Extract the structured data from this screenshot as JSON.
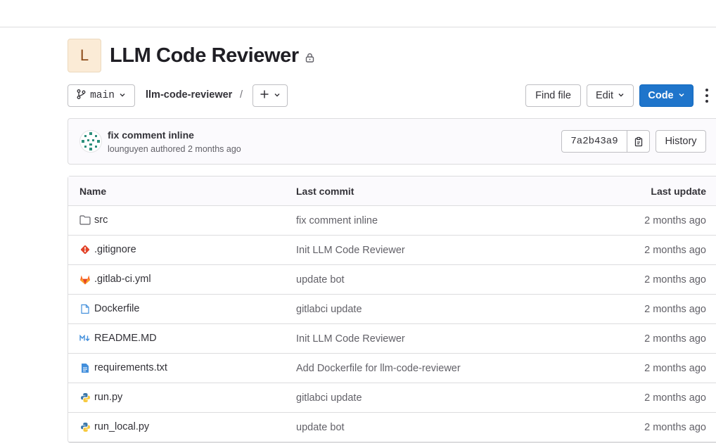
{
  "project": {
    "avatar_letter": "L",
    "name": "LLM Code Reviewer",
    "visibility_icon": "lock-icon"
  },
  "toolbar": {
    "branch": "main",
    "branch_icon": "branch-icon",
    "path_root": "llm-code-reviewer",
    "path_separator": "/",
    "add_icon": "plus-icon",
    "find_file_label": "Find file",
    "edit_label": "Edit",
    "code_label": "Code",
    "more_icon": "kebab-icon",
    "accent_color": "#1f75cb"
  },
  "last_commit": {
    "title": "fix comment inline",
    "meta": "lounguyen authored 2 months ago",
    "sha": "7a2b43a9",
    "copy_icon": "copy-icon",
    "history_label": "History"
  },
  "files": {
    "headers": {
      "name": "Name",
      "last_commit": "Last commit",
      "last_update": "Last update"
    },
    "rows": [
      {
        "name": "src",
        "icon": "folder-icon",
        "commit": "fix comment inline",
        "updated": "2 months ago"
      },
      {
        "name": ".gitignore",
        "icon": "git-icon",
        "commit": "Init LLM Code Reviewer",
        "updated": "2 months ago"
      },
      {
        "name": ".gitlab-ci.yml",
        "icon": "gitlab-icon",
        "commit": "update bot",
        "updated": "2 months ago"
      },
      {
        "name": "Dockerfile",
        "icon": "file-icon",
        "commit": "gitlabci update",
        "updated": "2 months ago"
      },
      {
        "name": "README.MD",
        "icon": "markdown-icon",
        "commit": "Init LLM Code Reviewer",
        "updated": "2 months ago"
      },
      {
        "name": "requirements.txt",
        "icon": "text-file-icon",
        "commit": "Add Dockerfile for llm-code-reviewer",
        "updated": "2 months ago"
      },
      {
        "name": "run.py",
        "icon": "python-icon",
        "commit": "gitlabci update",
        "updated": "2 months ago"
      },
      {
        "name": "run_local.py",
        "icon": "python-icon",
        "commit": "update bot",
        "updated": "2 months ago"
      }
    ]
  }
}
